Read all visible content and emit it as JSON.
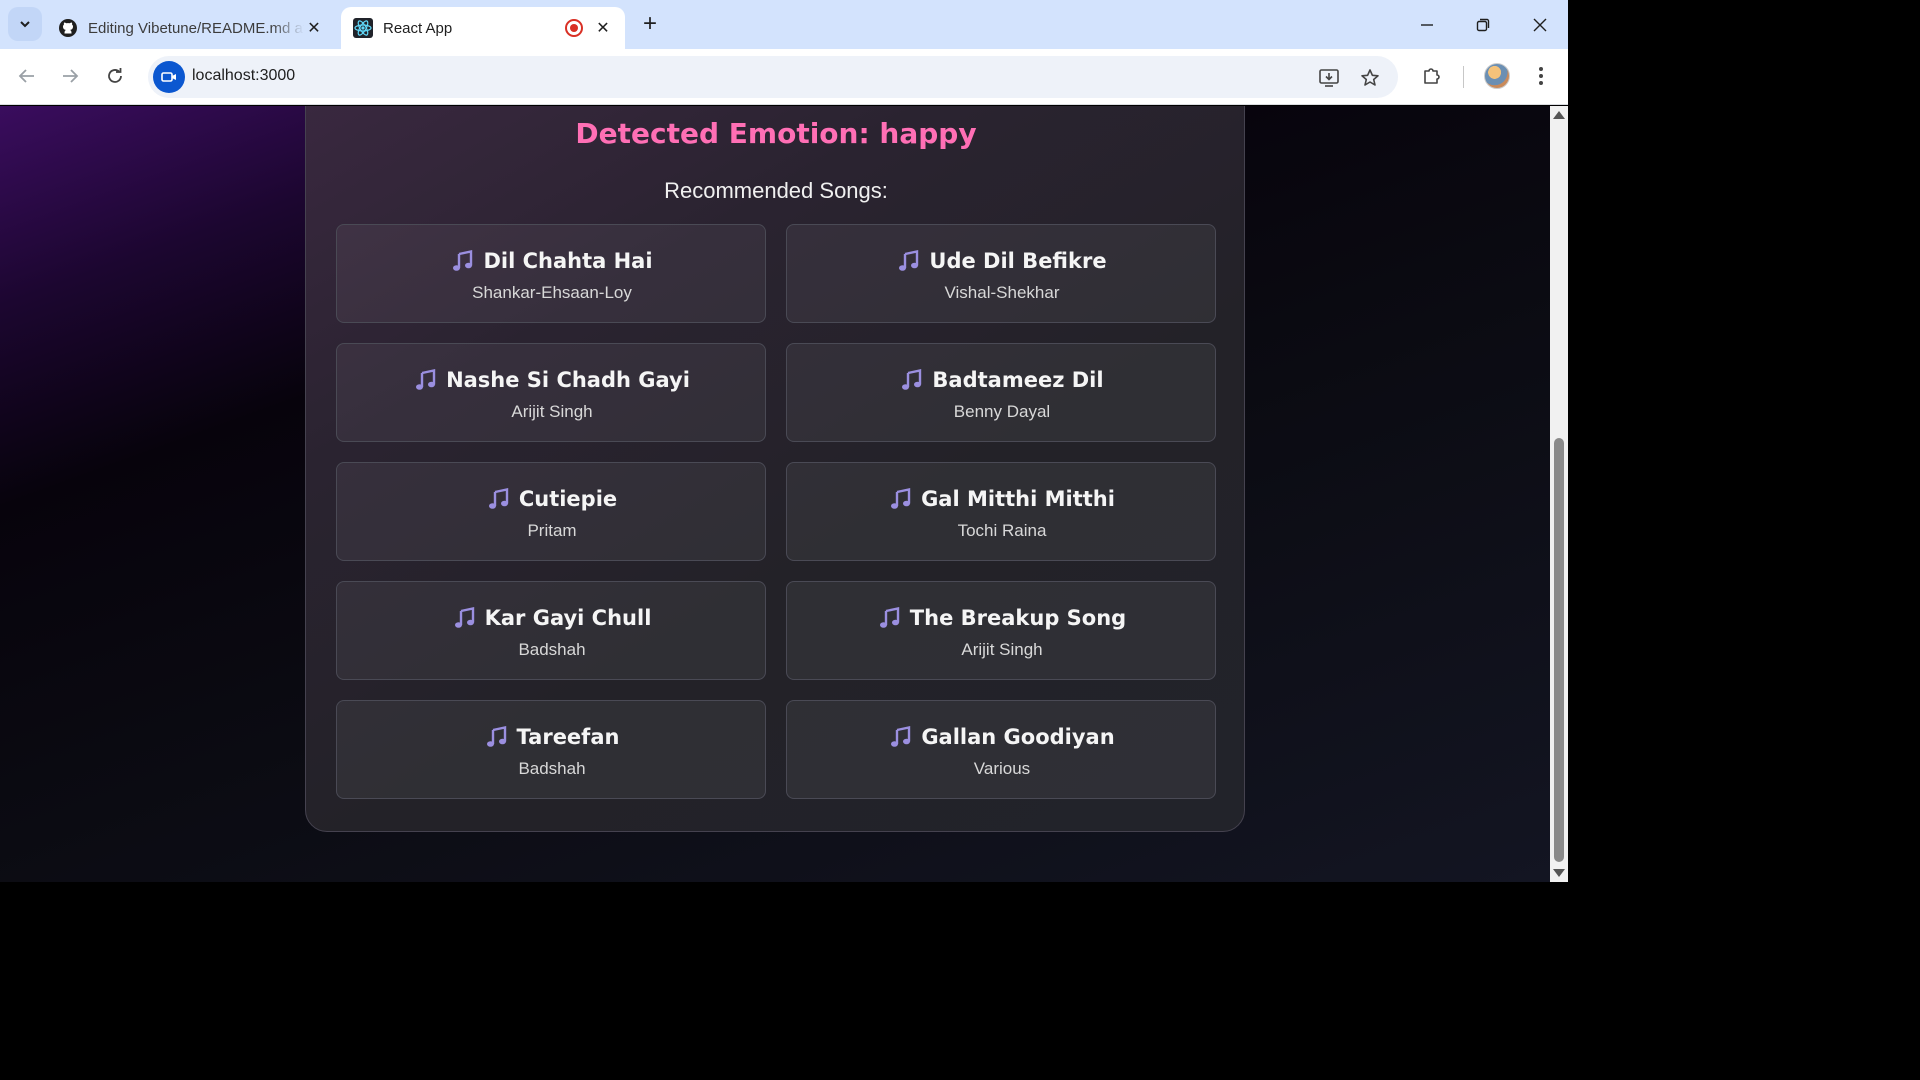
{
  "browser": {
    "tabs": [
      {
        "title": "Editing Vibetune/README.md at main",
        "favicon": "github-icon",
        "active": false
      },
      {
        "title": "React App",
        "favicon": "react-icon",
        "active": true,
        "recording": true
      }
    ],
    "address": "localhost:3000",
    "icons": {
      "tab_search": "chevron-down-icon",
      "new_tab": "plus-icon",
      "back": "arrow-left-icon",
      "forward": "arrow-right-icon",
      "reload": "reload-icon",
      "site_info": "video-camera-icon",
      "install": "install-app-icon",
      "bookmark": "star-icon",
      "extensions": "puzzle-icon",
      "profile": "avatar",
      "menu": "kebab-menu-icon",
      "minimize": "minimize-icon",
      "restore": "restore-icon",
      "close": "close-icon"
    }
  },
  "page": {
    "emotion_heading": "Detected Emotion: happy",
    "songs_heading": "Recommended Songs:",
    "songs": [
      {
        "title": "Dil Chahta Hai",
        "artist": "Shankar-Ehsaan-Loy"
      },
      {
        "title": "Ude Dil Befikre",
        "artist": "Vishal-Shekhar"
      },
      {
        "title": "Nashe Si Chadh Gayi",
        "artist": "Arijit Singh"
      },
      {
        "title": "Badtameez Dil",
        "artist": "Benny Dayal"
      },
      {
        "title": "Cutiepie",
        "artist": "Pritam"
      },
      {
        "title": "Gal Mitthi Mitthi",
        "artist": "Tochi Raina"
      },
      {
        "title": "Kar Gayi Chull",
        "artist": "Badshah"
      },
      {
        "title": "The Breakup Song",
        "artist": "Arijit Singh"
      },
      {
        "title": "Tareefan",
        "artist": "Badshah"
      },
      {
        "title": "Gallan Goodiyan",
        "artist": "Various"
      }
    ],
    "song_icon": "music-note-icon",
    "colors": {
      "emotion": "#ff6fb5",
      "note_icon": "#9b8fe0",
      "chrome_tabbar": "#d3e3fd"
    }
  }
}
